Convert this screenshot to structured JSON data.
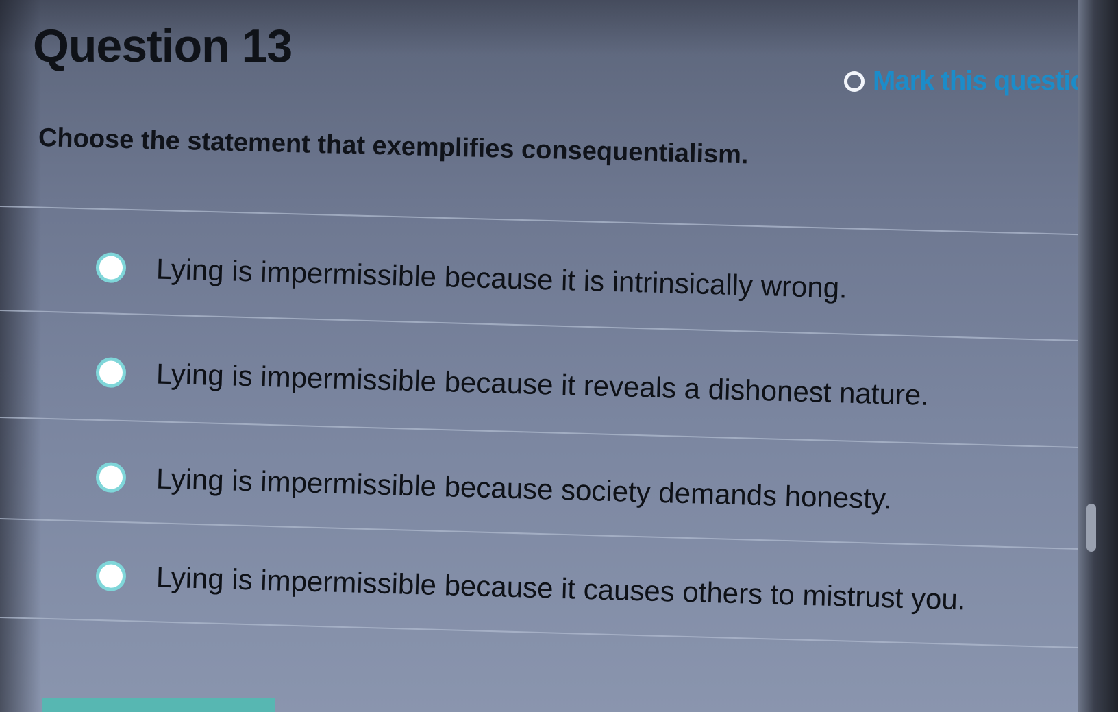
{
  "question": {
    "title": "Question 13",
    "mark_label": "Mark this question",
    "prompt": "Choose the statement that exemplifies consequentialism."
  },
  "options": [
    {
      "text": "Lying is impermissible because it is intrinsically wrong."
    },
    {
      "text": "Lying is impermissible because it reveals a dishonest nature."
    },
    {
      "text": "Lying is impermissible because society demands honesty."
    },
    {
      "text": "Lying is impermissible because it causes others to mistrust you."
    }
  ],
  "colors": {
    "background": "#6e7891",
    "radio_border": "#7fd6d9",
    "mark_link": "#1c8cc9",
    "accent_bar": "#57b7b2"
  },
  "icons": {
    "mark_toggle": "circle-outline-icon",
    "option_radio": "radio-empty-icon"
  }
}
